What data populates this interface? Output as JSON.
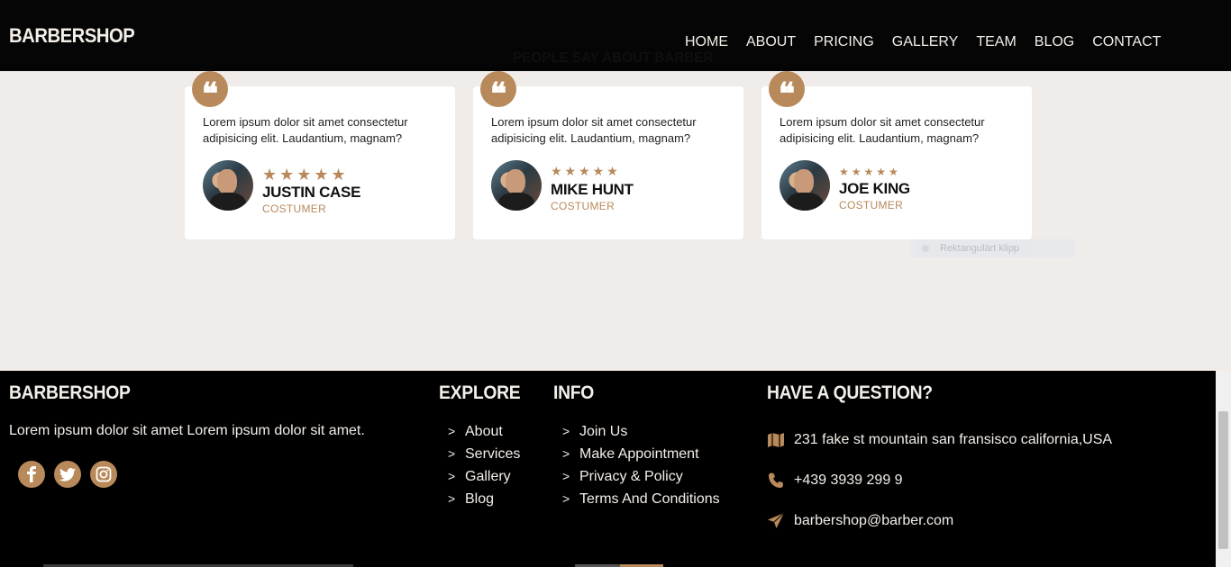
{
  "header": {
    "brand": "BARBERSHOP",
    "nav": [
      "HOME",
      "ABOUT",
      "PRICING",
      "GALLERY",
      "TEAM",
      "BLOG",
      "CONTACT"
    ]
  },
  "section": {
    "title": "PEOPLE SAY ABOUT BARBER"
  },
  "testimonials": [
    {
      "text": "Lorem ipsum dolor sit amet consectetur adipisicing elit. Laudantium, magnam?",
      "stars": "★★★★★",
      "name": "JUSTIN CASE",
      "role": "COSTUMER"
    },
    {
      "text": "Lorem ipsum dolor sit amet consectetur adipisicing elit. Laudantium, magnam?",
      "stars": "★★★★★",
      "name": "MIKE HUNT",
      "role": "COSTUMER"
    },
    {
      "text": "Lorem ipsum dolor sit amet consectetur adipisicing elit. Laudantium, magnam?",
      "stars": "★★★★★",
      "name": "JOE KING",
      "role": "COSTUMER"
    }
  ],
  "overlay": {
    "clip_label": "Rektangulärt klipp"
  },
  "footer": {
    "brand": "BARBERSHOP",
    "description": "Lorem ipsum dolor sit amet Lorem ipsum dolor sit amet.",
    "social_icons": [
      "facebook-icon",
      "twitter-icon",
      "instagram-icon"
    ],
    "explore": {
      "heading": "EXPLORE",
      "items": [
        "About",
        "Services",
        "Gallery",
        "Blog"
      ]
    },
    "info": {
      "heading": "INFO",
      "items": [
        "Join Us",
        "Make Appointment",
        "Privacy & Policy",
        "Terms And Conditions"
      ]
    },
    "contact": {
      "heading": "HAVE A QUESTION?",
      "address": "231 fake st mountain san fransisco california,USA",
      "phone": "+439 3939 299 9",
      "email": "barbershop@barber.com"
    }
  },
  "colors": {
    "accent": "#b8895a",
    "header_bg": "#050505",
    "page_bg": "#f0ecea",
    "card_bg": "#ffffff"
  }
}
